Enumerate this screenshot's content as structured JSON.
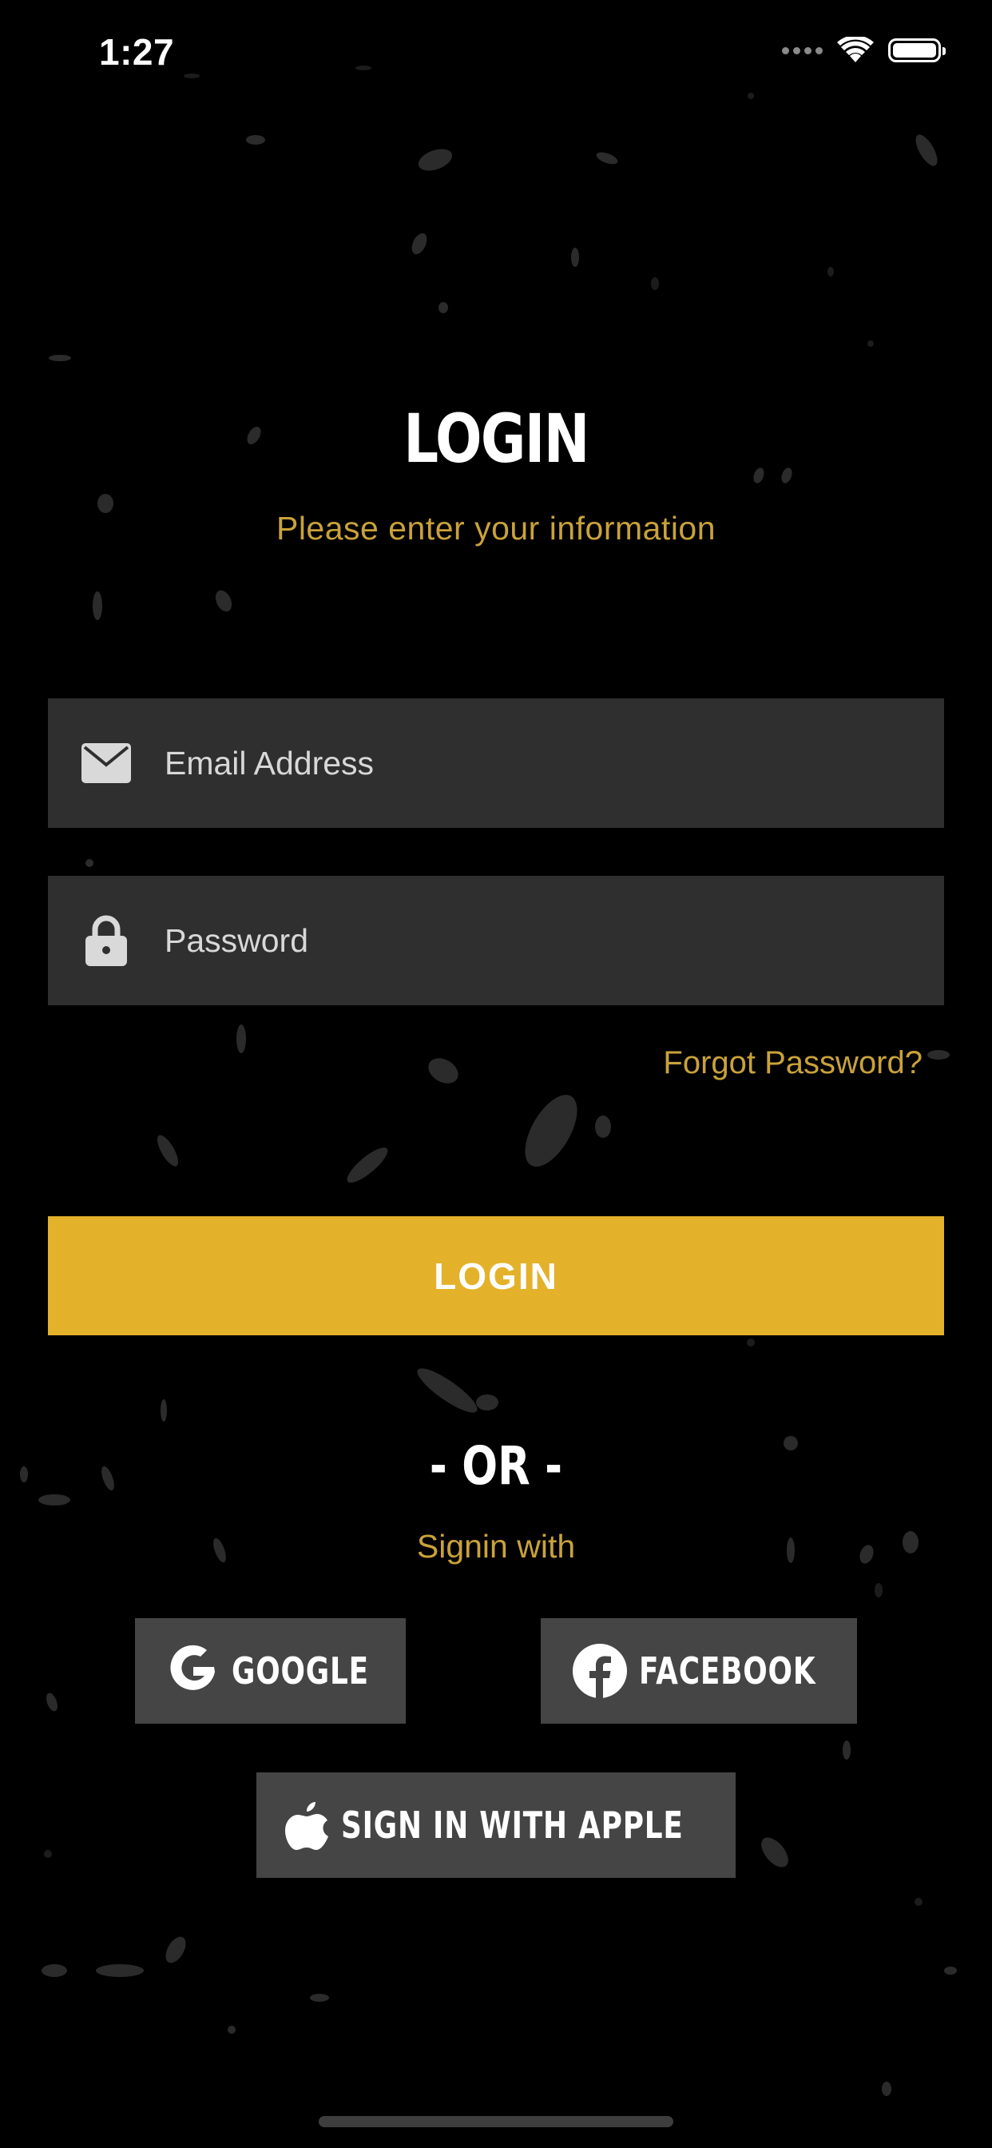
{
  "status_bar": {
    "time": "1:27",
    "icons": [
      "cellular-signal-icon",
      "wifi-icon",
      "battery-icon"
    ]
  },
  "login_screen": {
    "title": "LOGIN",
    "subtitle": "Please enter your information",
    "email_field": {
      "placeholder": "Email Address",
      "value": "",
      "icon": "envelope-icon"
    },
    "password_field": {
      "placeholder": "Password",
      "value": "",
      "icon": "lock-icon"
    },
    "forgot_password": "Forgot Password?",
    "login_button": "LOGIN",
    "divider": "- OR -",
    "signin_with": "Signin with",
    "social": {
      "google": "GOOGLE",
      "facebook": "FACEBOOK",
      "apple": "SIGN IN WITH APPLE"
    }
  },
  "colors": {
    "background": "#000000",
    "accent": "#e4b12a",
    "accent_text": "#c9a23a",
    "field_background": "#2f2f2f",
    "social_button_background": "#454545"
  }
}
